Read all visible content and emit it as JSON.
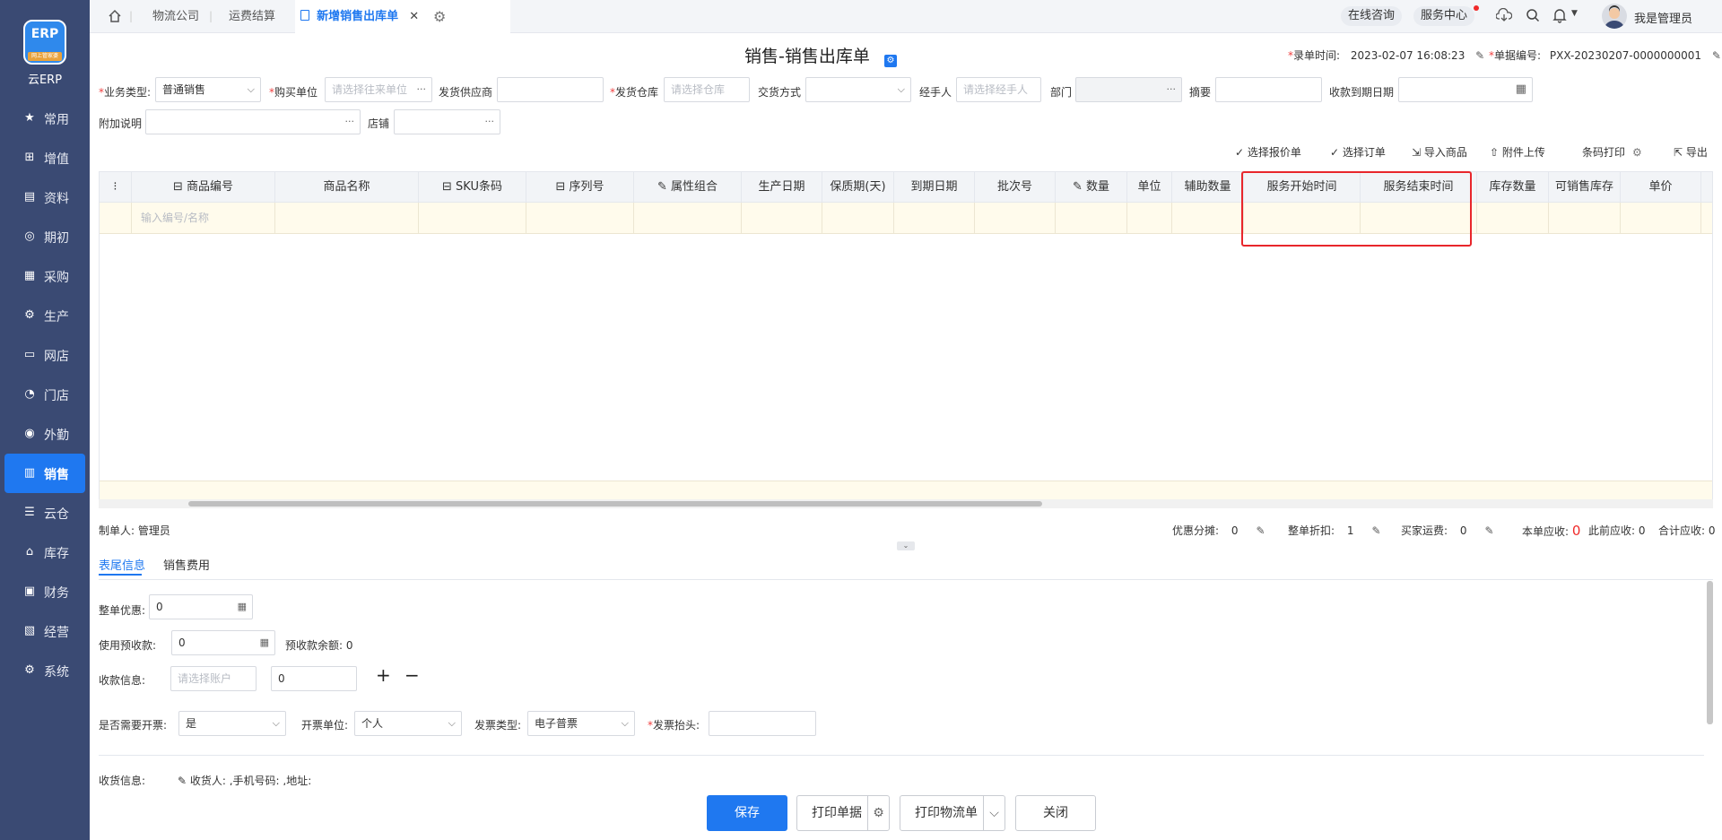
{
  "sidebar": {
    "brand": "云ERP",
    "logo_text": "ERP",
    "logo_badge": "网上管家婆",
    "items": [
      {
        "label": "常用",
        "icon": "star-icon"
      },
      {
        "label": "增值",
        "icon": "plus-square-icon"
      },
      {
        "label": "资料",
        "icon": "document-icon"
      },
      {
        "label": "期初",
        "icon": "target-icon"
      },
      {
        "label": "采购",
        "icon": "purchase-icon"
      },
      {
        "label": "生产",
        "icon": "production-icon"
      },
      {
        "label": "网店",
        "icon": "shop-icon"
      },
      {
        "label": "门店",
        "icon": "pie-icon"
      },
      {
        "label": "外勤",
        "icon": "field-icon"
      },
      {
        "label": "销售",
        "icon": "chart-icon",
        "active": true
      },
      {
        "label": "云仓",
        "icon": "warehouse-icon"
      },
      {
        "label": "库存",
        "icon": "home-icon"
      },
      {
        "label": "财务",
        "icon": "finance-icon"
      },
      {
        "label": "经营",
        "icon": "operation-icon"
      },
      {
        "label": "系统",
        "icon": "gear-icon"
      }
    ]
  },
  "topbar": {
    "tabs": [
      "物流公司",
      "运费结算",
      "新增销售出库单"
    ],
    "online": "在线咨询",
    "service": "服务中心",
    "user": "我是管理员"
  },
  "header": {
    "title": "销售-销售出库单",
    "date_label": "录单时间:",
    "date_value": "2023-02-07 16:08:23",
    "no_label": "单据编号:",
    "no_value": "PXX-20230207-0000000001"
  },
  "form": {
    "biz_type_label": "业务类型:",
    "biz_type_value": "普通销售",
    "buyer_label": "购买单位",
    "buyer_ph": "请选择往来单位",
    "supplier_label": "发货供应商",
    "warehouse_label": "发货仓库",
    "warehouse_ph": "请选择仓库",
    "delivery_label": "交货方式",
    "handler_label": "经手人",
    "handler_ph": "请选择经手人",
    "dept_label": "部门",
    "summary_label": "摘要",
    "due_label": "收款到期日期",
    "note_label": "附加说明",
    "store_label": "店铺"
  },
  "actions": [
    "选择报价单",
    "选择订单",
    "导入商品",
    "附件上传",
    "条码打印",
    "导出"
  ],
  "grid": {
    "columns": [
      "商品编号",
      "商品名称",
      "SKU条码",
      "序列号",
      "属性组合",
      "生产日期",
      "保质期(天)",
      "到期日期",
      "批次号",
      "数量",
      "单位",
      "辅助数量",
      "服务开始时间",
      "服务结束时间",
      "库存数量",
      "可销售库存",
      "单价"
    ],
    "row_placeholder": "输入编号/名称"
  },
  "summary": {
    "maker_label": "制单人:",
    "maker": "管理员",
    "discount_label": "优惠分摊:",
    "discount": "0",
    "rate_label": "整单折扣:",
    "rate": "1",
    "freight_label": "买家运费:",
    "freight": "0",
    "due_label": "本单应收:",
    "due": "0",
    "prev_label": "此前应收:",
    "prev": "0",
    "total_label": "合计应收:",
    "total": "0"
  },
  "subtabs": [
    "表尾信息",
    "销售费用"
  ],
  "tail": {
    "whole_discount_label": "整单优惠:",
    "whole_discount": "0",
    "prepay_label": "使用预收款:",
    "prepay": "0",
    "prepay_balance_label": "预收款余额:",
    "prepay_balance": "0",
    "receipt_label": "收款信息:",
    "account_ph": "请选择账户",
    "receipt_amount": "0",
    "invoice_label": "是否需要开票:",
    "invoice_value": "是",
    "invoice_unit_label": "开票单位:",
    "invoice_unit_value": "个人",
    "invoice_type_label": "发票类型:",
    "invoice_type_value": "电子普票",
    "invoice_title_label": "发票抬头:",
    "shipping_label": "收货信息:",
    "shipping_text": "收货人: ,手机号码: ,地址:"
  },
  "footer": {
    "save": "保存",
    "print": "打印单据",
    "print_logistics": "打印物流单",
    "close": "关闭"
  },
  "colors": {
    "sidebar": "#3a4a73",
    "accent": "#1f78f0",
    "highlight": "#e8262b"
  }
}
